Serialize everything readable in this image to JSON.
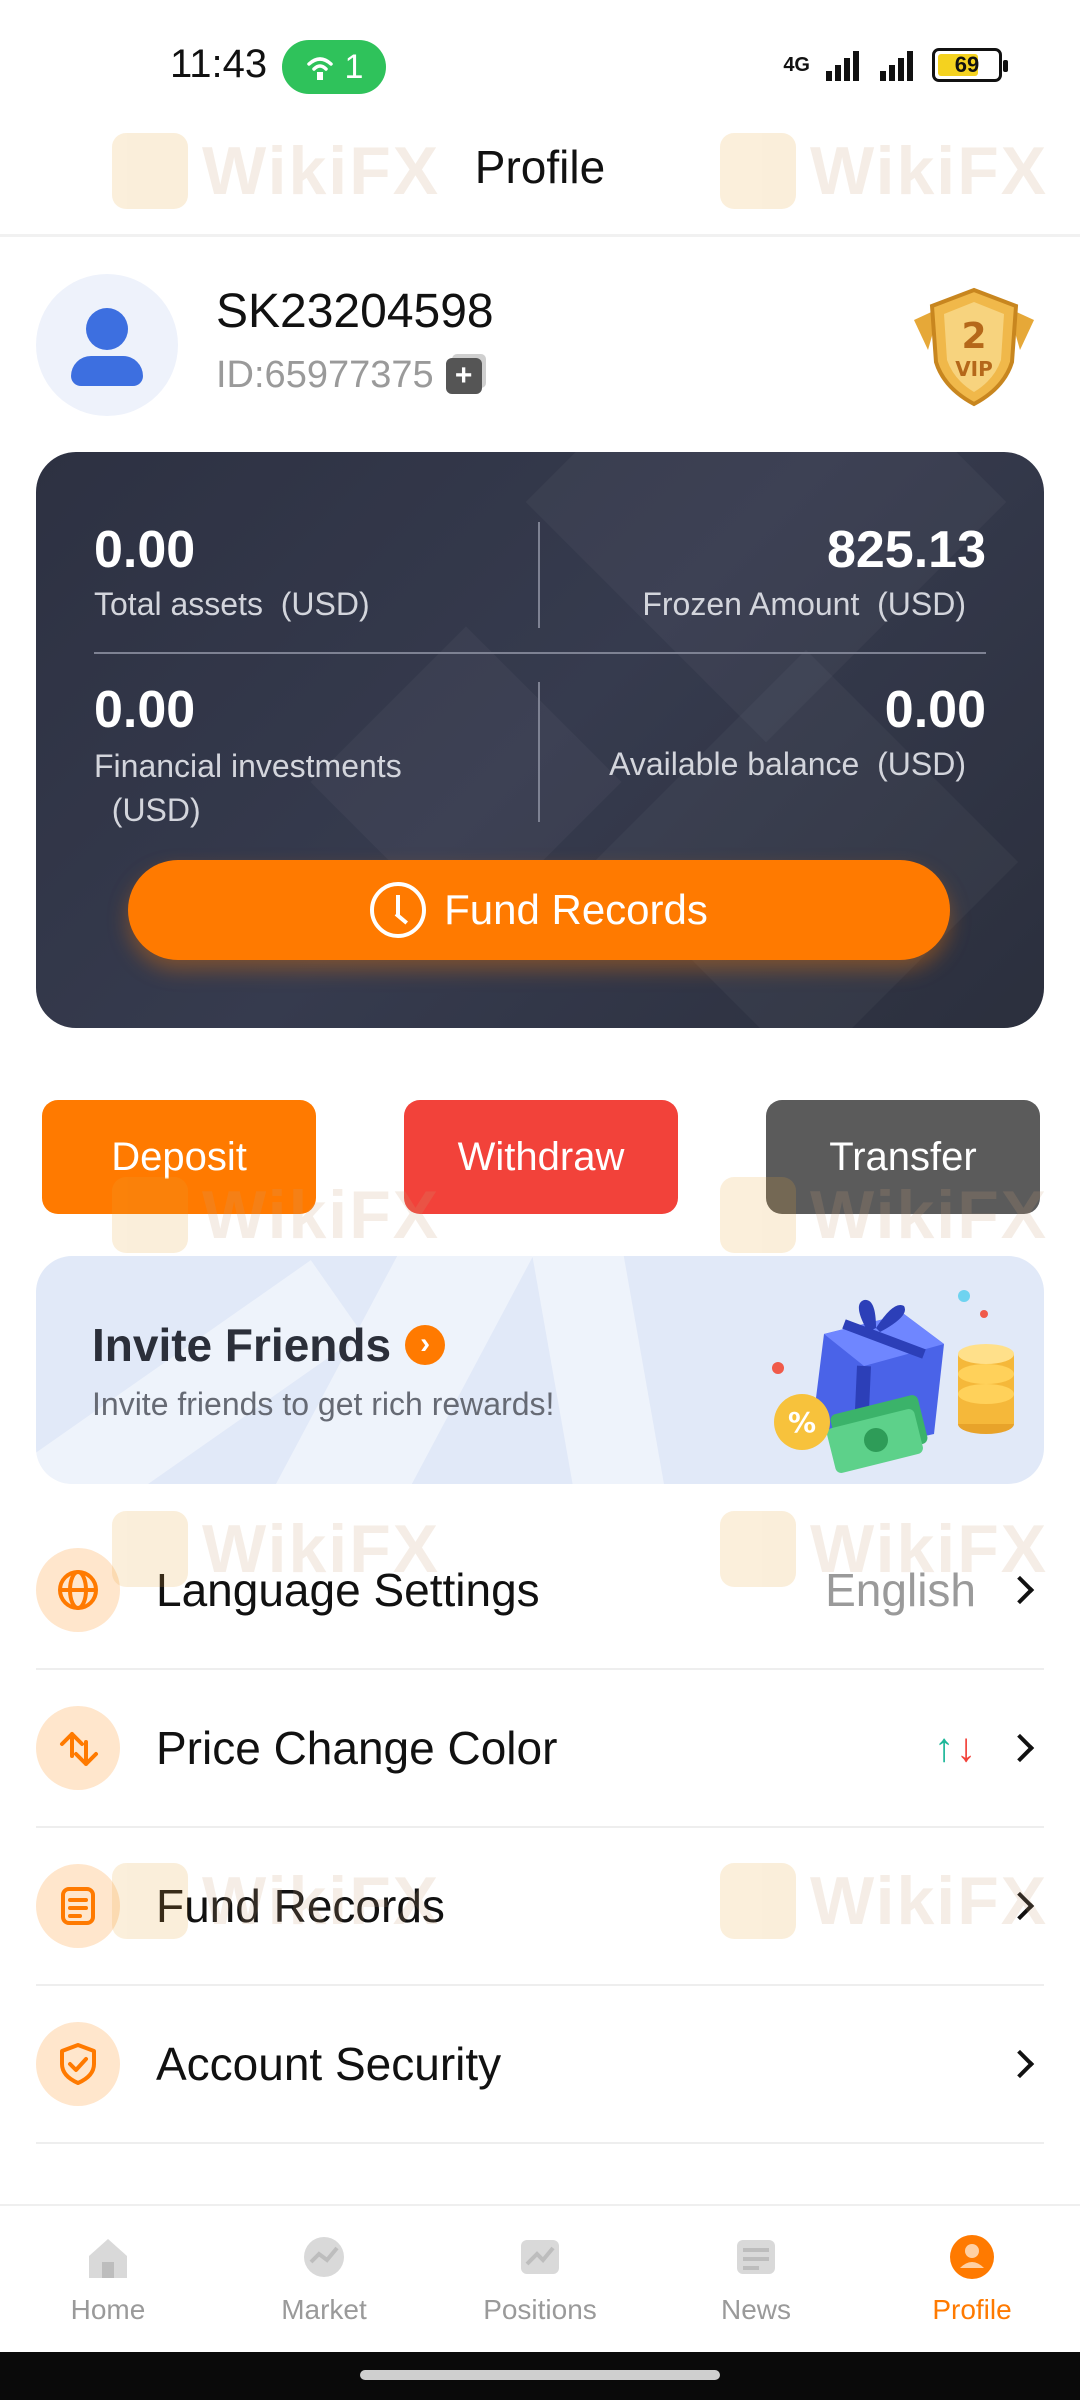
{
  "status_bar": {
    "time": "11:43",
    "hotspot_count": "1",
    "network": "4G",
    "battery": "69",
    "battery_level": 0.69
  },
  "header": {
    "title": "Profile"
  },
  "watermark": "WikiFX",
  "user": {
    "username": "SK23204598",
    "id": "ID:65977375",
    "vip_level": "2",
    "vip_label": "VIP"
  },
  "balance": {
    "total_assets": {
      "value": "0.00",
      "label": "Total assets",
      "unit": "(USD)"
    },
    "frozen_amount": {
      "value": "825.13",
      "label": "Frozen Amount",
      "unit": "(USD)"
    },
    "financial_investments": {
      "value": "0.00",
      "label": "Financial investments",
      "unit": "(USD)"
    },
    "available_balance": {
      "value": "0.00",
      "label": "Available balance",
      "unit": "(USD)"
    },
    "fund_records_button": "Fund Records"
  },
  "actions": {
    "deposit": "Deposit",
    "withdraw": "Withdraw",
    "transfer": "Transfer"
  },
  "invite": {
    "title": "Invite Friends",
    "subtitle": "Invite friends to get rich rewards!"
  },
  "settings": {
    "language": {
      "label": "Language Settings",
      "value": "English"
    },
    "price_color": {
      "label": "Price Change Color"
    },
    "fund_records": {
      "label": "Fund Records"
    },
    "account_security": {
      "label": "Account Security"
    }
  },
  "nav": {
    "home": "Home",
    "market": "Market",
    "positions": "Positions",
    "news": "News",
    "profile": "Profile"
  },
  "colors": {
    "accent": "#ff7a00",
    "withdraw": "#f2423a",
    "transfer": "#5b5b5b",
    "card": "#2d3142",
    "up": "#1fb89a",
    "down": "#f2423a"
  }
}
